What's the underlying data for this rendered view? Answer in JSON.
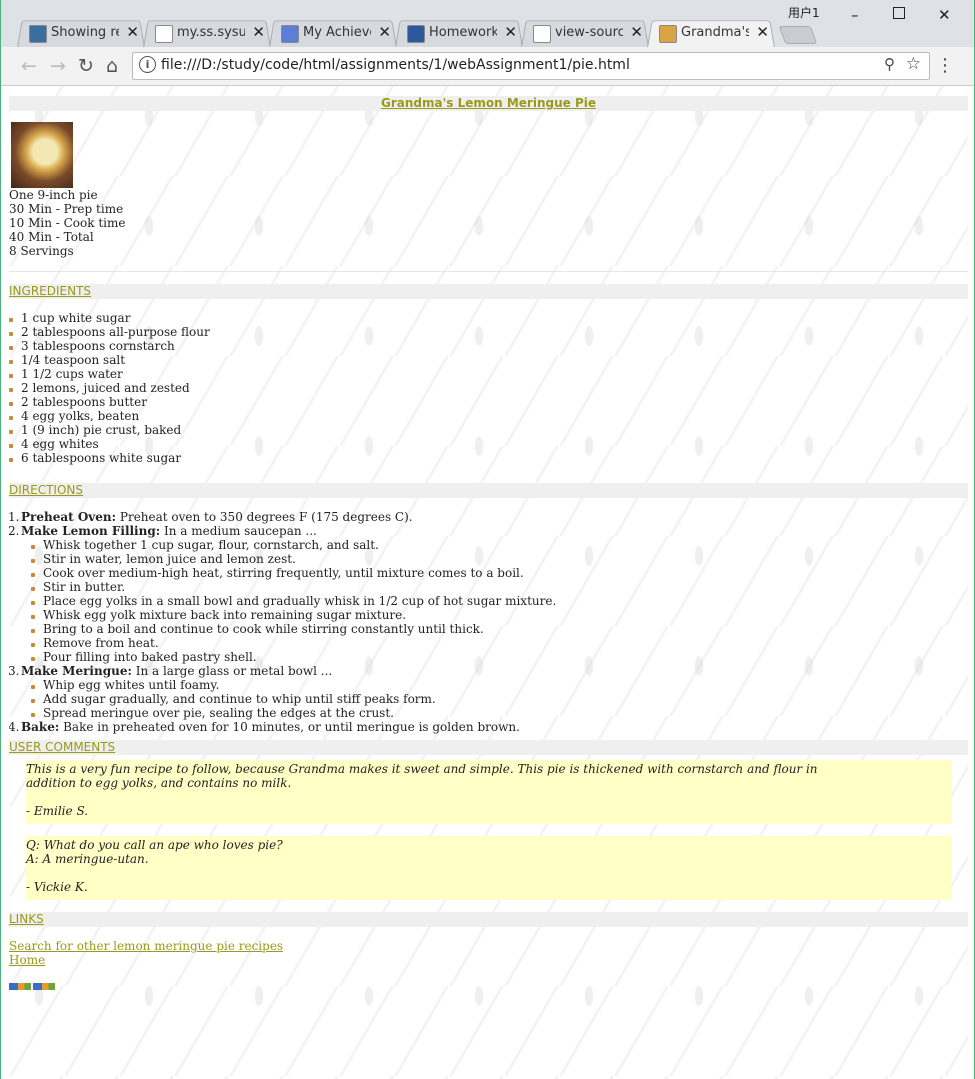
{
  "browser": {
    "user_label": "用户1",
    "tabs": [
      {
        "title": "Showing re"
      },
      {
        "title": "my.ss.sysu.e"
      },
      {
        "title": "My Achieve"
      },
      {
        "title": "Homework"
      },
      {
        "title": "view-source"
      },
      {
        "title": "Grandma's"
      }
    ],
    "url": "file:///D:/study/code/html/assignments/1/webAssignment1/pie.html"
  },
  "page": {
    "title": "Grandma's Lemon Meringue Pie",
    "facts": [
      "One 9-inch pie",
      "30 Min - Prep time",
      "10 Min - Cook time",
      "40 Min - Total",
      "8 Servings"
    ],
    "ingredients_heading": "INGREDIENTS",
    "ingredients": [
      "1 cup white sugar",
      "2 tablespoons all-purpose flour",
      "3 tablespoons cornstarch",
      "1/4 teaspoon salt",
      "1 1/2 cups water",
      "2 lemons, juiced and zested",
      "2 tablespoons butter",
      "4 egg yolks, beaten",
      "1 (9 inch) pie crust, baked",
      "4 egg whites",
      "6 tablespoons white sugar"
    ],
    "directions_heading": "DIRECTIONS",
    "directions": [
      {
        "num": "1.",
        "label": "Preheat Oven:",
        "text": " Preheat oven to 350 degrees F (175 degrees C).",
        "sub": []
      },
      {
        "num": "2.",
        "label": "Make Lemon Filling:",
        "text": " In a medium saucepan ...",
        "sub": [
          "Whisk together 1 cup sugar, flour, cornstarch, and salt.",
          "Stir in water, lemon juice and lemon zest.",
          "Cook over medium-high heat, stirring frequently, until mixture comes to a boil.",
          "Stir in butter.",
          "Place egg yolks in a small bowl and gradually whisk in 1/2 cup of hot sugar mixture.",
          "Whisk egg yolk mixture back into remaining sugar mixture.",
          "Bring to a boil and continue to cook while stirring constantly until thick.",
          "Remove from heat.",
          "Pour filling into baked pastry shell."
        ]
      },
      {
        "num": "3.",
        "label": "Make Meringue:",
        "text": " In a large glass or metal bowl ...",
        "sub": [
          "Whip egg whites until foamy.",
          "Add sugar gradually, and continue to whip until stiff peaks form.",
          "Spread meringue over pie, sealing the edges at the crust."
        ]
      },
      {
        "num": "4.",
        "label": "Bake:",
        "text": " Bake in preheated oven for 10 minutes, or until meringue is golden brown.",
        "sub": []
      }
    ],
    "comments_heading": "USER COMMENTS",
    "comments": [
      {
        "lines": [
          "This is a very fun recipe to follow, because Grandma makes it sweet and simple. This pie is thickened with cornstarch and flour in",
          "addition to egg yolks, and contains no milk.",
          "",
          "- Emilie S."
        ]
      },
      {
        "lines": [
          "Q: What do you call an ape who loves pie?",
          "A: A meringue-utan.",
          "",
          "- Vickie K."
        ]
      }
    ],
    "links_heading": "LINKS",
    "links": [
      "Search for other lemon meringue pie recipes",
      "Home"
    ]
  }
}
